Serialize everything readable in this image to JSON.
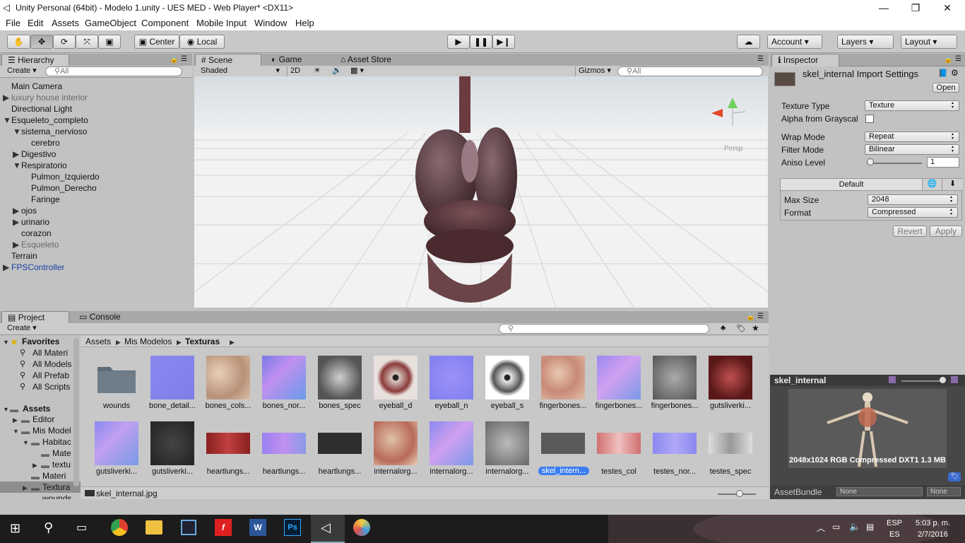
{
  "window": {
    "title": "Unity Personal (64bit) - Modelo 1.unity - UES MED - Web Player* <DX11>"
  },
  "menu": [
    "File",
    "Edit",
    "Assets",
    "GameObject",
    "Component",
    "Mobile Input",
    "Window",
    "Help"
  ],
  "toolbar": {
    "center": "Center",
    "local": "Local",
    "account": "Account",
    "layers": "Layers",
    "layout": "Layout"
  },
  "hierarchy": {
    "tab": "Hierarchy",
    "create": "Create",
    "search_placeholder": "All",
    "items": [
      "Main Camera",
      "luxury house interior",
      "Directional Light",
      "Esqueleto_completo",
      "sistema_nervioso",
      "cerebro",
      "Digestivo",
      "Respiratorio",
      "Pulmon_Izquierdo",
      "Pulmon_Derecho",
      "Faringe",
      "ojos",
      "urinario",
      "corazon",
      "Esqueleto",
      "Terrain",
      "FPSController"
    ]
  },
  "scene": {
    "tabs": [
      "Scene",
      "Game",
      "Asset Store"
    ],
    "shading": "Shaded",
    "mode2d": "2D",
    "gizmos": "Gizmos",
    "search_placeholder": "All",
    "persp": "Persp"
  },
  "inspector": {
    "tab": "Inspector",
    "title": "skel_internal Import Settings",
    "open": "Open",
    "texture_type_label": "Texture Type",
    "texture_type": "Texture",
    "alpha_label": "Alpha from Grayscal",
    "wrap_label": "Wrap Mode",
    "wrap": "Repeat",
    "filter_label": "Filter Mode",
    "filter": "Bilinear",
    "aniso_label": "Aniso Level",
    "aniso": "1",
    "platform_tab": "Default",
    "maxsize_label": "Max Size",
    "maxsize": "2048",
    "format_label": "Format",
    "format": "Compressed",
    "revert": "Revert",
    "apply": "Apply"
  },
  "preview": {
    "name": "skel_internal",
    "info": "2048x1024  RGB Compressed DXT1   1.3 MB",
    "assetbundle_label": "AssetBundle",
    "ab_none1": "None",
    "ab_none2": "None"
  },
  "project": {
    "tabs": [
      "Project",
      "Console"
    ],
    "create": "Create",
    "favorites_label": "Favorites",
    "favorites": [
      "All Materi",
      "All Models",
      "All Prefab",
      "All Scripts"
    ],
    "assets_label": "Assets",
    "tree": [
      "Editor",
      "Mis Model",
      "Habitac",
      "Mate",
      "textu",
      "Materi",
      "Textura",
      "wounds"
    ],
    "breadcrumb": [
      "Assets",
      "Mis Modelos",
      "Texturas"
    ],
    "row1": [
      "wounds",
      "bone_detail...",
      "bones_cols...",
      "bones_nor...",
      "bones_spec",
      "eyeball_d",
      "eyeball_n",
      "eyeball_s",
      "fingerbones...",
      "fingerbones...",
      "fingerbones...",
      "gutsliverki..."
    ],
    "row2": [
      "gutsliverki...",
      "gutsliverki...",
      "heartlungs...",
      "heartlungs...",
      "heartlungs...",
      "internalorg...",
      "internalorg...",
      "internalorg...",
      "skel_intern...",
      "testes_col",
      "testes_nor...",
      "testes_spec"
    ],
    "selected_file": "skel_internal.jpg"
  },
  "taskbar": {
    "lang1": "ESP",
    "lang2": "ES",
    "time": "5:03 p. m.",
    "date": "2/7/2016"
  }
}
